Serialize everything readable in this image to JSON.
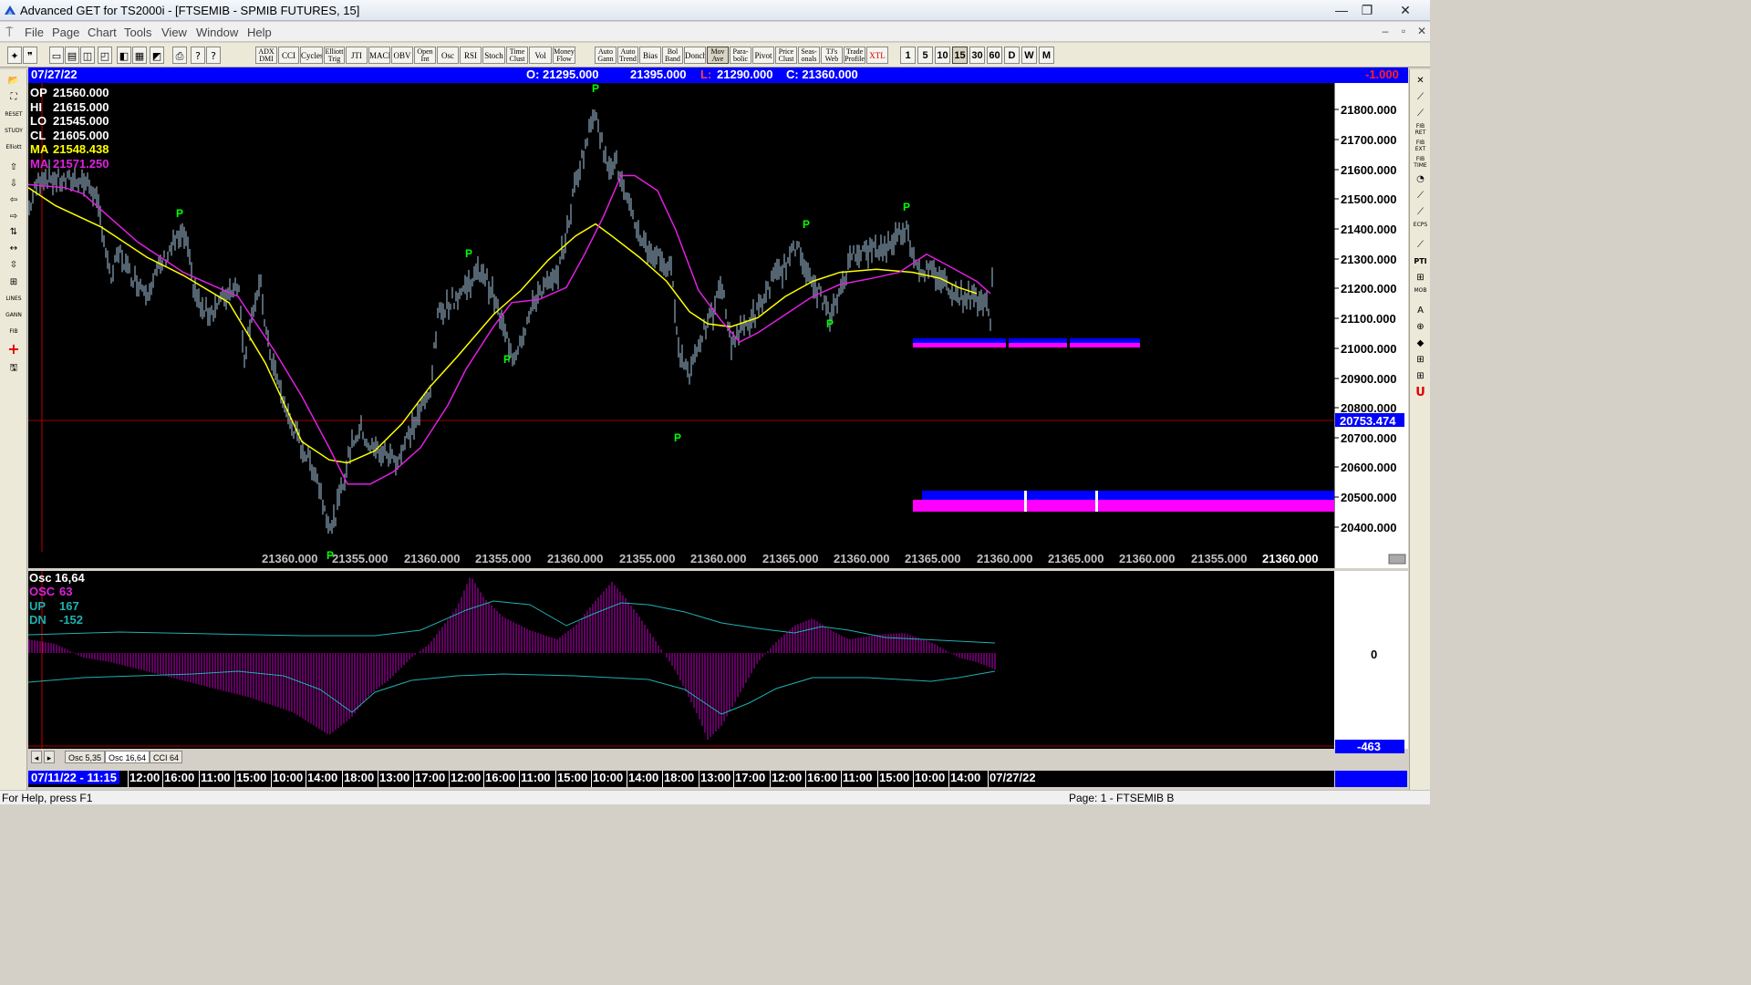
{
  "window": {
    "title": "Advanced GET for TS2000i - [FTSEMIB - SPMIB FUTURES, 15]",
    "minimize": "—",
    "restore": "❐",
    "close": "✕"
  },
  "menu": [
    "File",
    "Page",
    "Chart",
    "Tools",
    "View",
    "Window",
    "Help"
  ],
  "mdi": {
    "min": "–",
    "restore": "▫",
    "close": "✕"
  },
  "toolbar": {
    "left_icons": [
      "✦",
      "❞",
      "▭",
      "▤",
      "◫",
      "◰",
      "◧",
      "▦",
      "◩",
      "⎙",
      "?",
      "?"
    ],
    "studies": [
      {
        "l1": "ADX",
        "l2": "DMI"
      },
      {
        "l1": "CCI",
        "l2": ""
      },
      {
        "l1": "Cycles",
        "l2": ""
      },
      {
        "l1": "Elliott",
        "l2": "Trig"
      },
      {
        "l1": "JTI",
        "l2": ""
      },
      {
        "l1": "MACD",
        "l2": ""
      },
      {
        "l1": "OBV",
        "l2": ""
      },
      {
        "l1": "Open",
        "l2": "Int"
      },
      {
        "l1": "Osc",
        "l2": ""
      },
      {
        "l1": "RSI",
        "l2": ""
      },
      {
        "l1": "Stoch",
        "l2": ""
      },
      {
        "l1": "Time",
        "l2": "Clust"
      },
      {
        "l1": "Vol",
        "l2": ""
      },
      {
        "l1": "Money",
        "l2": "Flow"
      },
      {
        "l1": "Auto",
        "l2": "Gann"
      },
      {
        "l1": "Auto",
        "l2": "Trend"
      },
      {
        "l1": "Bias",
        "l2": ""
      },
      {
        "l1": "Bol",
        "l2": "Band"
      },
      {
        "l1": "Donch",
        "l2": ""
      },
      {
        "l1": "Mov",
        "l2": "Ave"
      },
      {
        "l1": "Para-",
        "l2": "bolic"
      },
      {
        "l1": "Pivot",
        "l2": ""
      },
      {
        "l1": "Price",
        "l2": "Clust"
      },
      {
        "l1": "Seas-",
        "l2": "onals"
      },
      {
        "l1": "TJ's",
        "l2": "Web"
      },
      {
        "l1": "Trade",
        "l2": "Profile"
      },
      {
        "l1": "XTL",
        "l2": ""
      }
    ],
    "timeframes": [
      "1",
      "5",
      "10",
      "15",
      "30",
      "60",
      "D",
      "W",
      "M"
    ],
    "active_timeframe": "15"
  },
  "lefttools": [
    "📂",
    "⛶",
    "RESET",
    "STUDY",
    "Elliott",
    "⇧",
    "⇩",
    "⇦",
    "⇨",
    "⇅",
    "↔",
    "⇳",
    "⊞",
    "LINES",
    "GANN",
    "FIB",
    "+",
    "🖫"
  ],
  "righttools": [
    "✕",
    "⟋",
    "⟋",
    "FIB RET",
    "FIB EXT",
    "FIB TIME",
    "◔",
    "⟋",
    "⟋",
    "ECPS",
    "⟋",
    "PTI",
    "⊞",
    "MOB",
    "A",
    "⊕",
    "◆",
    "⊞",
    "⊞",
    "U"
  ],
  "info": {
    "date": "07/27/22",
    "open": "O: 21295.000",
    "high": "21395.000",
    "low_label": "L:",
    "low": "21290.000",
    "close": "C: 21360.000",
    "change": "-1.000"
  },
  "legend": {
    "op": "OP",
    "op_val": "21560.000",
    "hi": "HI",
    "hi_val": "21615.000",
    "lo": "LO",
    "lo_val": "21545.000",
    "cl": "CL",
    "cl_val": "21605.000",
    "ma1": "MA",
    "ma1_val": "21548.438",
    "ma2": "MA",
    "ma2_val": "21571.250"
  },
  "price_axis": [
    "21800.000",
    "21700.000",
    "21600.000",
    "21500.000",
    "21400.000",
    "21300.000",
    "21200.000",
    "21100.000",
    "21000.000",
    "20900.000",
    "20800.000",
    "20700.000",
    "20600.000",
    "20500.000",
    "20400.000"
  ],
  "price_marker": "20753.474",
  "pivot_letter": "P",
  "bottom_values": [
    "21360.000",
    "21355.000",
    "21360.000",
    "21355.000",
    "21360.000",
    "21355.000",
    "21360.000",
    "21365.000",
    "21360.000",
    "21365.000",
    "21360.000",
    "21365.000",
    "21360.000",
    "21355.000",
    "21360.000"
  ],
  "osc": {
    "title": "Osc 16,64",
    "osc_label": "OSC",
    "osc_val": "63",
    "up_label": "UP",
    "up_val": "167",
    "dn_label": "DN",
    "dn_val": "-152",
    "zero": "0",
    "current": "-463"
  },
  "tabs": [
    "Osc 5,35",
    "Osc 16,64",
    "CCI 64"
  ],
  "timeaxis": [
    "07/11/22 - 11:15",
    "12:00",
    "16:00",
    "11:00",
    "15:00",
    "10:00",
    "14:00",
    "18:00",
    "13:00",
    "17:00",
    "12:00",
    "16:00",
    "11:00",
    "15:00",
    "10:00",
    "14:00",
    "18:00",
    "13:00",
    "17:00",
    "12:00",
    "16:00",
    "11:00",
    "15:00",
    "10:00",
    "14:00",
    "07/27/22"
  ],
  "status": {
    "help": "For Help, press F1",
    "page": "Page: 1 - FTSEMIB B"
  },
  "colors": {
    "bars": "#a8c8e0",
    "ma_fast": "#ffff00",
    "ma_slow": "#e020e0",
    "pivot": "#00ff00",
    "zone_blue": "#0000ff",
    "zone_magenta": "#ff00ff",
    "osc_hist": "#c000c0",
    "osc_band": "#20b0b0"
  }
}
